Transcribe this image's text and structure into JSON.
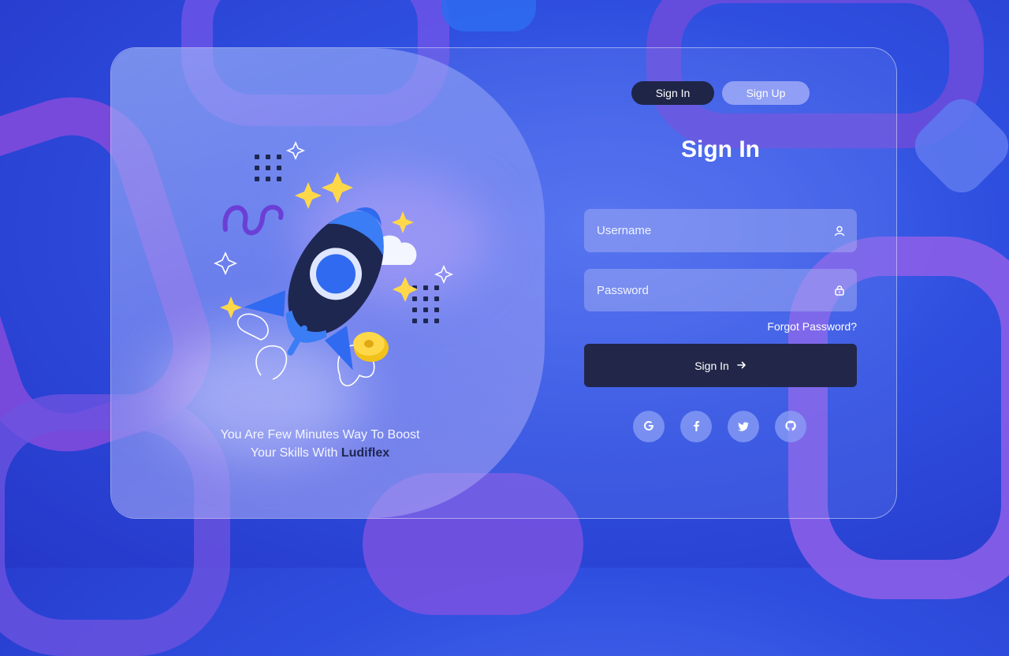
{
  "tabs": {
    "signin_label": "Sign In",
    "signup_label": "Sign Up"
  },
  "form": {
    "title": "Sign In",
    "username_placeholder": "Username",
    "password_placeholder": "Password",
    "forgot_label": "Forgot Password?",
    "submit_label": "Sign In",
    "submit_icon": "arrow-right-icon"
  },
  "social": [
    "google-icon",
    "facebook-icon",
    "twitter-icon",
    "github-icon"
  ],
  "hero": {
    "tagline_line1": "You Are Few Minutes Way To Boost",
    "tagline_line2_prefix": "Your Skills With",
    "brand": "Ludiflex"
  },
  "colors": {
    "dark_navy": "#222749",
    "accent_blue": "#3a6ff3",
    "background": "#2f4fe0"
  }
}
